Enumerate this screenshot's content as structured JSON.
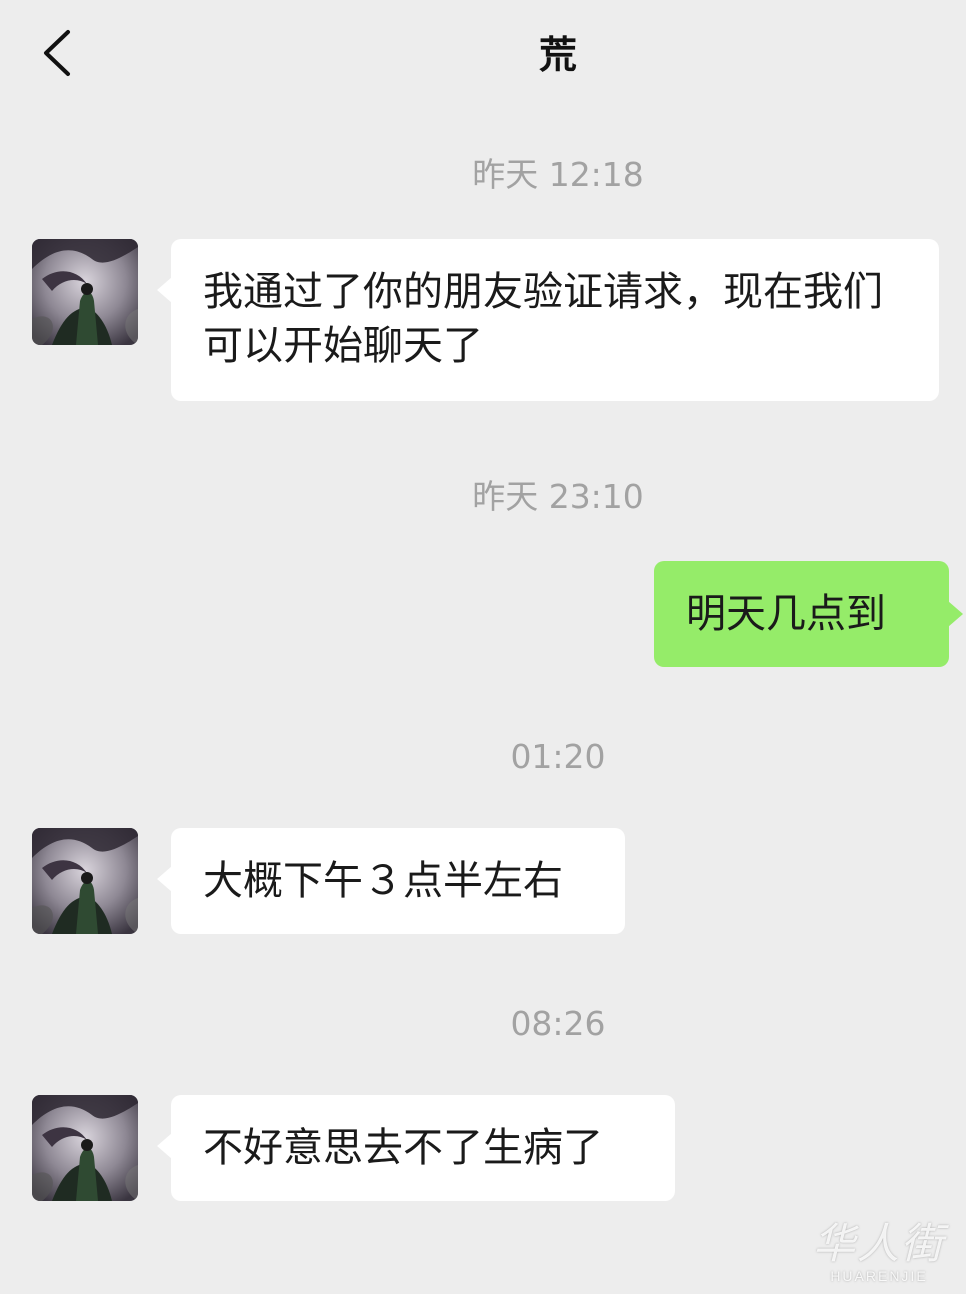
{
  "header": {
    "title": "荒",
    "back_icon": "chevron-left-icon"
  },
  "messages": [
    {
      "type": "timestamp",
      "text": "昨天 12:18"
    },
    {
      "type": "received",
      "text": "我通过了你的朋友验证请求，现在我们可以开始聊天了"
    },
    {
      "type": "timestamp",
      "text": "昨天 23:10"
    },
    {
      "type": "sent",
      "text": "明天几点到"
    },
    {
      "type": "timestamp",
      "text": "01:20"
    },
    {
      "type": "received",
      "text": "大概下午３点半左右"
    },
    {
      "type": "timestamp",
      "text": "08:26"
    },
    {
      "type": "received",
      "text": "不好意思去不了生病了"
    }
  ],
  "colors": {
    "background": "#ededed",
    "received_bubble": "#ffffff",
    "sent_bubble": "#95ec69",
    "timestamp": "#a2a2a2"
  },
  "watermark": {
    "cn": "华人街",
    "en": "HUARENJIE"
  }
}
